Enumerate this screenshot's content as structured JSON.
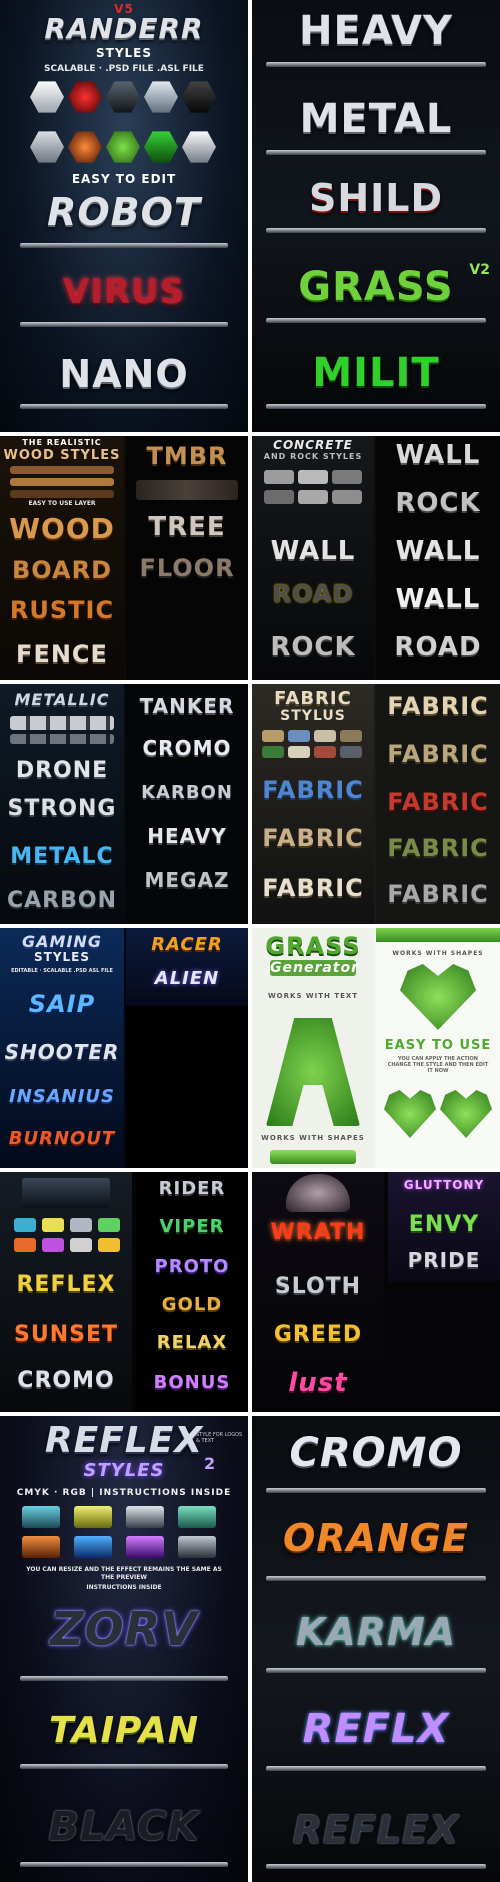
{
  "p1": {
    "head": "V5",
    "title": "RANDERR",
    "subtitle": "STYLES",
    "features": "SCALABLE · .PSD FILE .ASL FILE",
    "easy": "EASY TO EDIT",
    "rows": [
      "ROBOT",
      "VIRUS",
      "NANO"
    ]
  },
  "p2": {
    "rows": [
      "HEAVY",
      "METAL",
      "SHILD",
      "GRASS",
      "MILIT"
    ],
    "grass_badge": "V2"
  },
  "wood": {
    "title1": "THE REALISTIC",
    "title2": "WOOD STYLES",
    "note": "EASY TO USE LAYER",
    "left": [
      "WOOD",
      "BOARD",
      "RUSTIC",
      "FENCE"
    ],
    "right": [
      "TMBR",
      "TREE",
      "FLOOR"
    ]
  },
  "concrete": {
    "title1": "CONCRETE",
    "title2": "AND ROCK STYLES",
    "left": [
      "WALL",
      "ROAD",
      "ROCK"
    ],
    "right": [
      "WALL",
      "ROCK",
      "WALL",
      "WALL",
      "ROAD"
    ]
  },
  "metallic": {
    "title": "METALLIC",
    "left": [
      "DRONE",
      "STRONG",
      "METALC",
      "CARBON"
    ],
    "right": [
      "TANKER",
      "CROMO",
      "KARBON",
      "HEAVY",
      "MEGAZ"
    ]
  },
  "fabric": {
    "title1": "FABRIC",
    "title2": "STYLUS",
    "left": [
      "FABRIC",
      "FABRIC",
      "FABRIC"
    ],
    "right": [
      "FABRIC",
      "FABRIC",
      "FABRIC",
      "FABRIC",
      "FABRIC"
    ]
  },
  "gaming": {
    "title1": "GAMING",
    "title2": "STYLES",
    "note": "EDITABLE · SCALABLE .PSD ASL FILE",
    "rows": [
      "SAIP",
      "SHOOTER",
      "INSANIUS",
      "BURNOUT"
    ],
    "right": [
      "RACER",
      "ALIEN"
    ]
  },
  "grass": {
    "title": "GRASS",
    "subtitle": "Generator",
    "works_text": "WORKS WITH TEXT",
    "works_shapes": "WORKS WITH SHAPES",
    "easy": "EASY TO USE",
    "easy_desc": "YOU CAN APPLY THE ACTION CHANGE THE STYLE AND THEN EDIT IT NOW"
  },
  "reflex_small": {
    "left": [
      "REFLEX",
      "SUNSET",
      "CROMO"
    ],
    "right": [
      "RIDER",
      "VIPER",
      "PROTO",
      "GOLD",
      "RELAX",
      "BONUS"
    ]
  },
  "sins": {
    "left": [
      "WRATH",
      "SLOTH",
      "GREED",
      "lust"
    ],
    "right_title": "GLUTTONY",
    "right": [
      "ENVY",
      "PRIDE"
    ]
  },
  "reflex_big": {
    "title": "REFLEX",
    "subtitle": "STYLES",
    "badge": "2",
    "side": "STYLE FOR LOGOS & TEXT",
    "instr": "CMYK · RGB | INSTRUCTIONS INSIDE",
    "resize": "YOU CAN RESIZE AND THE EFFECT REMAINS THE SAME AS THE PREVIEW",
    "instr2": "INSTRUCTIONS INSIDE",
    "rows": [
      "ZORV",
      "TAIPAN",
      "BLACK"
    ]
  },
  "cromo_big": {
    "rows": [
      "CROMO",
      "ORANGE",
      "KARMA",
      "REFLX",
      "REFLEX"
    ]
  }
}
